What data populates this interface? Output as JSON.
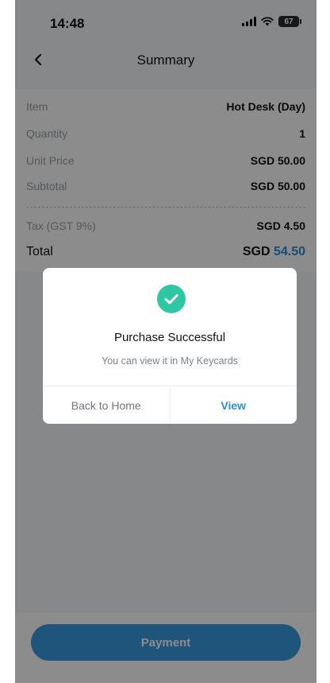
{
  "status_bar": {
    "time": "14:48",
    "battery": "67"
  },
  "nav": {
    "title": "Summary"
  },
  "summary": {
    "rows": [
      {
        "label": "Item",
        "value": "Hot Desk (Day)"
      },
      {
        "label": "Quantity",
        "value": "1"
      },
      {
        "label": "Unit Price",
        "value": "SGD 50.00"
      },
      {
        "label": "Subtotal",
        "value": "SGD 50.00"
      },
      {
        "label": "Tax (GST 9%)",
        "value": "SGD 4.50"
      }
    ],
    "total": {
      "label": "Total",
      "currency": "SGD",
      "amount": "54.50"
    }
  },
  "footer": {
    "payment_label": "Payment"
  },
  "modal": {
    "title": "Purchase Successful",
    "subtitle": "You can view it in My Keycards",
    "back_label": "Back to Home",
    "view_label": "View"
  },
  "colors": {
    "accent": "#2b8fd6",
    "success": "#2fc7a3",
    "button": "#3a9be0"
  }
}
